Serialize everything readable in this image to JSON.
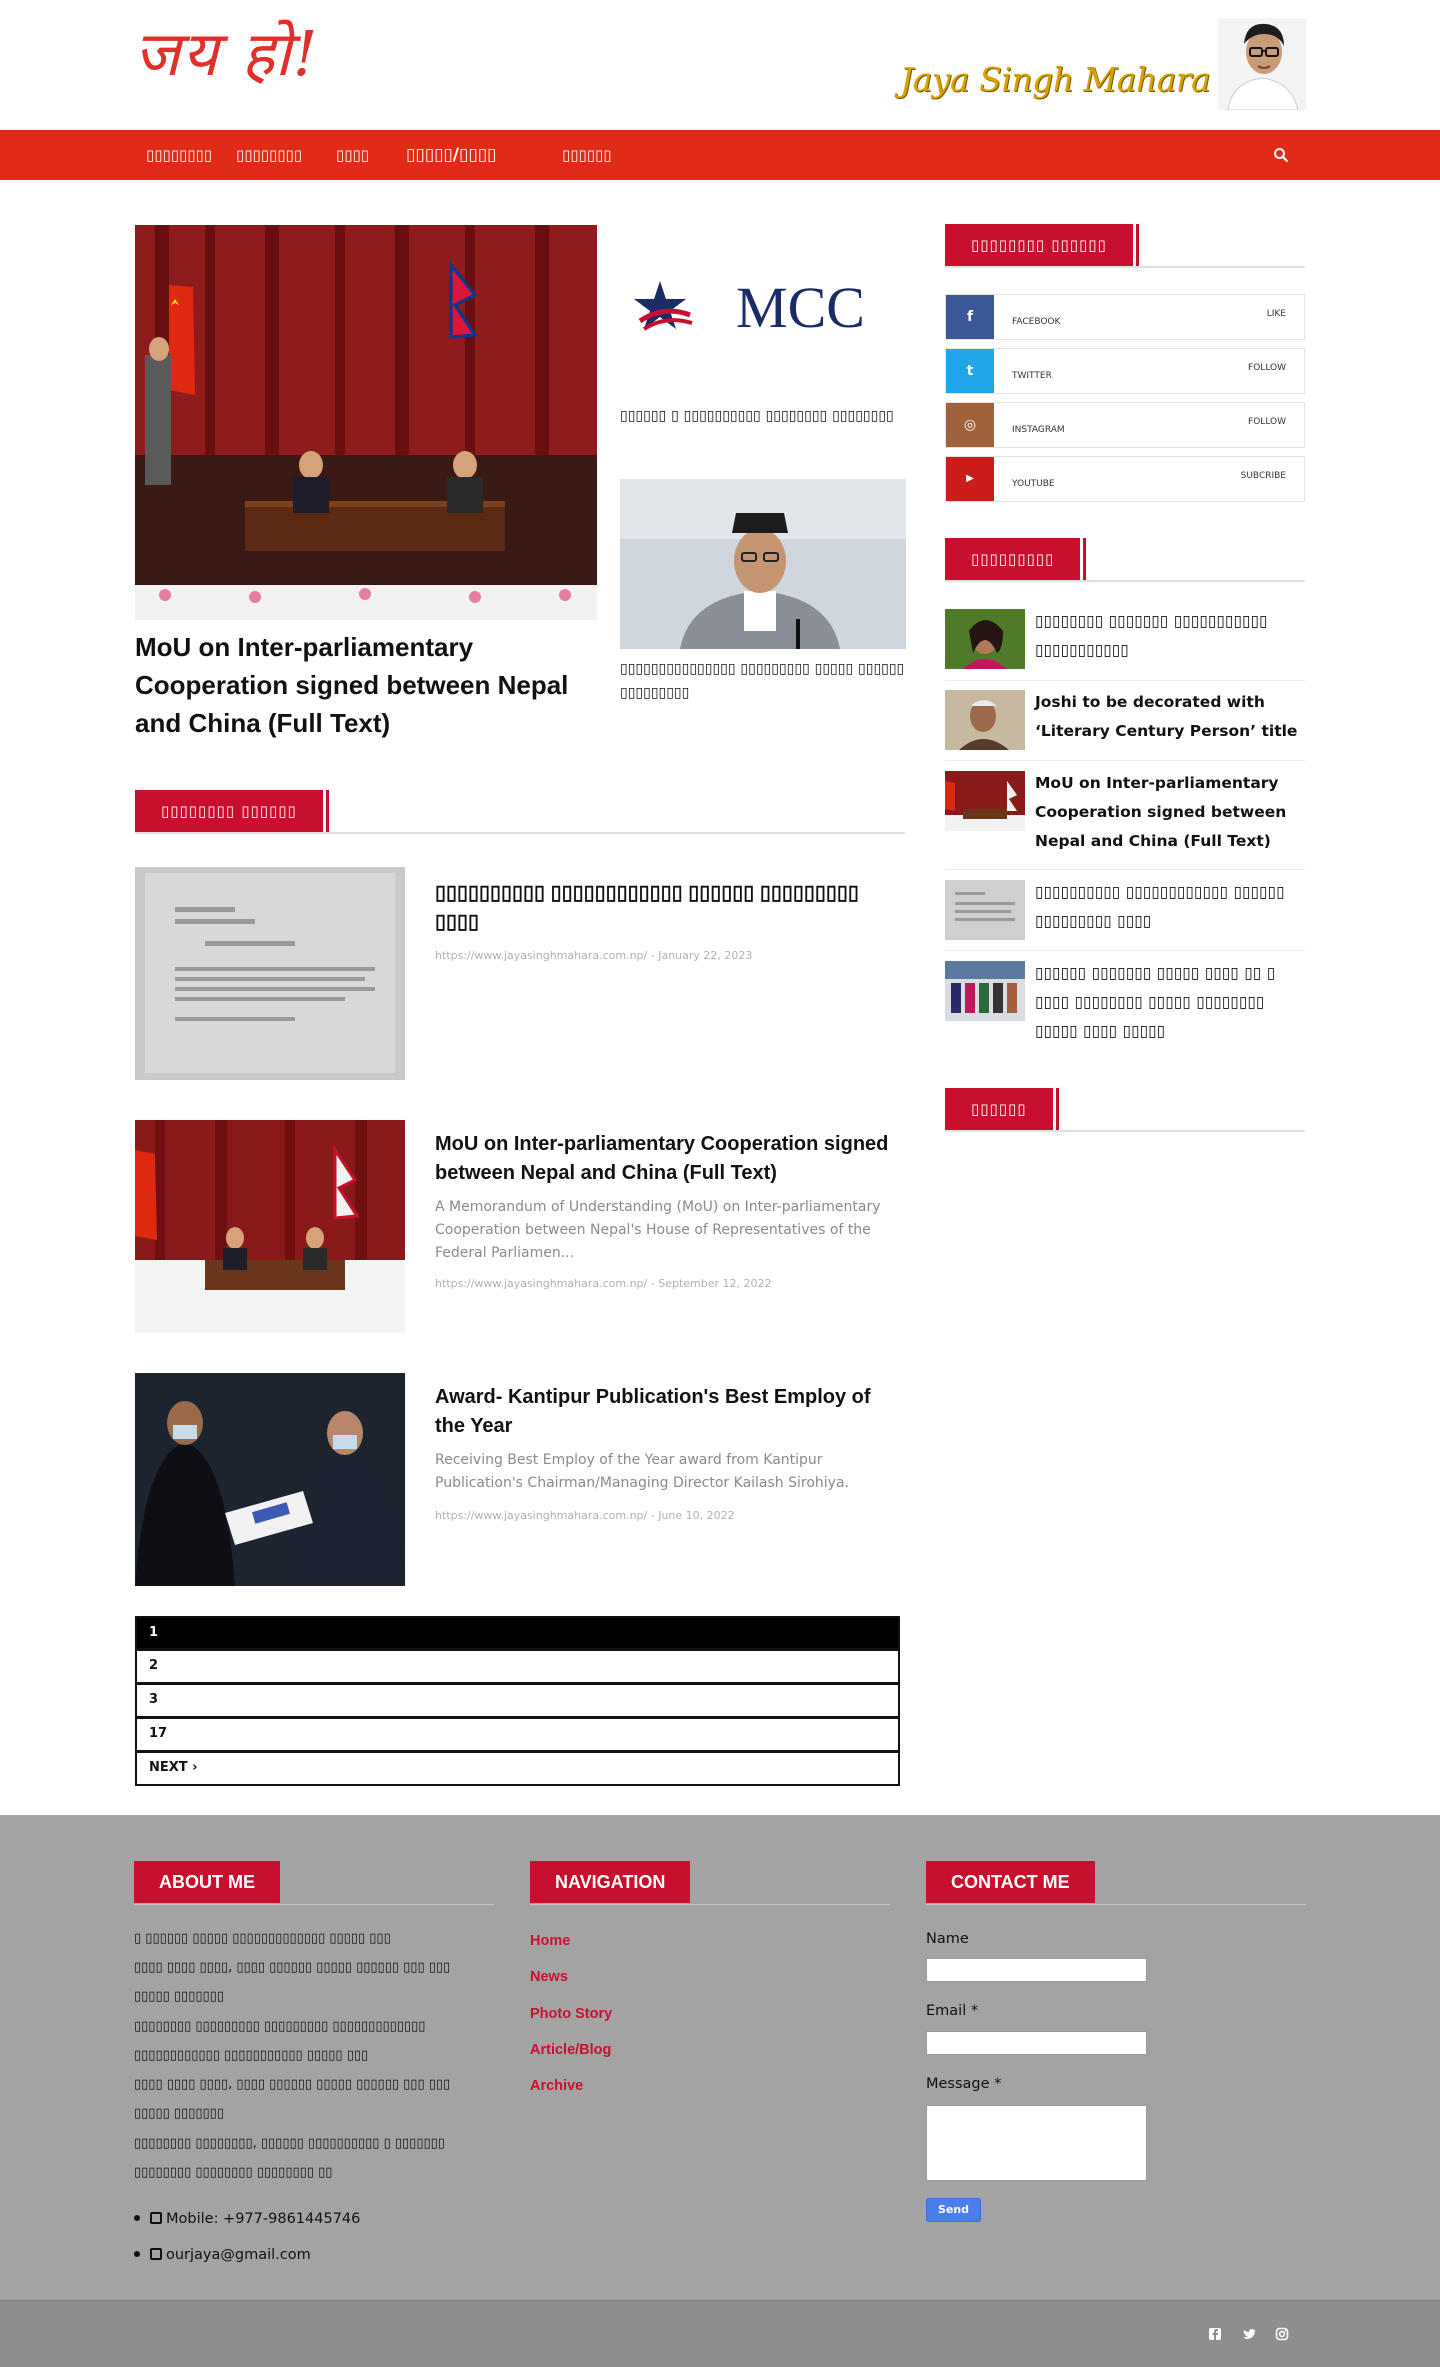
{
  "header": {
    "logo_text": "जय हो!",
    "banner_name": "Jaya Singh Mahara"
  },
  "nav": {
    "items": [
      "▯▯▯▯▯▯▯▯",
      "▯▯▯▯▯▯▯▯",
      "▯▯▯▯",
      "▯▯▯▯▯/▯▯▯▯",
      "▯▯▯▯▯▯"
    ],
    "search_icon": "search-icon"
  },
  "hero": {
    "main_title": "MoU on Inter-parliamentary Cooperation signed between Nepal and China (Full Text)",
    "side1_logo_text": "MCC",
    "side1_title": "▯▯▯▯▯▯ ▯ ▯▯▯▯▯▯▯▯▯▯ ▯▯▯▯▯▯▯▯ ▯▯▯▯▯▯▯▯",
    "side2_title": "▯▯▯▯▯▯▯▯▯▯▯▯▯▯▯ ▯▯▯▯▯▯▯▯▯ ▯▯▯▯▯ ▯▯▯▯▯▯ ▯▯▯▯▯▯▯▯▯"
  },
  "latest": {
    "heading": "▯▯▯▯▯▯▯▯ ▯▯▯▯▯▯",
    "posts": [
      {
        "title": "▯▯▯▯▯▯▯▯▯▯ ▯▯▯▯▯▯▯▯▯▯▯▯ ▯▯▯▯▯▯ ▯▯▯▯▯▯▯▯▯ ▯▯▯▯",
        "excerpt": "",
        "meta": "https://www.jayasinghmahara.com.np/ - January 22, 2023"
      },
      {
        "title": "MoU on Inter-parliamentary Cooperation signed between Nepal and China (Full Text)",
        "excerpt": "A Memorandum of Understanding (MoU) on Inter-parliamentary Cooperation between Nepal's House of Representatives of the Federal Parliamen...",
        "meta": "https://www.jayasinghmahara.com.np/ - September 12, 2022"
      },
      {
        "title": "Award- Kantipur Publication's Best Employ of the Year",
        "excerpt": "  Receiving Best Employ of the Year award from Kantipur Publication's Chairman/Managing Director Kailash Sirohiya.",
        "meta": "https://www.jayasinghmahara.com.np/ - June 10, 2022"
      }
    ],
    "pagination": [
      "1",
      "2",
      "3",
      "17",
      "NEXT ›"
    ]
  },
  "sidebar": {
    "follow_heading": "▯▯▯▯▯▯▯▯ ▯▯▯▯▯▯",
    "social": [
      {
        "icon": "f",
        "name": "FACEBOOK",
        "action": "LIKE",
        "color": "#3b5998"
      },
      {
        "icon": "t",
        "name": "TWITTER",
        "action": "FOLLOW",
        "color": "#1ea6e8"
      },
      {
        "icon": "◎",
        "name": "INSTAGRAM",
        "action": "FOLLOW",
        "color": "#a0613c"
      },
      {
        "icon": "▶",
        "name": "YOUTUBE",
        "action": "SUBCRIBE",
        "color": "#cc1d1d"
      }
    ],
    "popular_heading": "▯▯▯▯▯▯▯▯▯",
    "popular": [
      "▯▯▯▯▯▯▯▯ ▯▯▯▯▯▯▯ ▯▯▯▯▯▯▯▯▯▯▯ ▯▯▯▯▯▯▯▯▯▯▯",
      "Joshi to be decorated with ‘Literary Century Person’ title",
      "MoU on Inter-parliamentary Cooperation signed between Nepal and China (Full Text)",
      "▯▯▯▯▯▯▯▯▯▯ ▯▯▯▯▯▯▯▯▯▯▯▯ ▯▯▯▯▯▯ ▯▯▯▯▯▯▯▯▯ ▯▯▯▯",
      "▯▯▯▯▯▯ ▯▯▯▯▯▯▯ ▯▯▯▯▯ ▯▯▯▯ ▯▯ ▯ ▯▯▯▯ ▯▯▯▯▯▯▯▯ ▯▯▯▯▯ ▯▯▯▯▯▯▯▯ ▯▯▯▯▯ ▯▯▯▯ ▯▯▯▯▯"
    ],
    "third_heading": "▯▯▯▯▯▯"
  },
  "footer": {
    "about_heading": "ABOUT ME",
    "about_lines": [
      "▯ ▯▯▯▯▯▯ ▯▯▯▯▯ ▯▯▯▯▯▯▯▯▯▯▯▯▯ ▯▯▯▯▯ ▯▯▯",
      "▯▯▯▯ ▯▯▯▯ ▯▯▯▯, ▯▯▯▯ ▯▯▯▯▯▯ ▯▯▯▯▯ ▯▯▯▯▯▯ ▯▯▯ ▯▯▯",
      "▯▯▯▯▯ ▯▯▯▯▯▯▯",
      "▯▯▯▯▯▯▯▯ ▯▯▯▯▯▯▯▯▯ ▯▯▯▯▯▯▯▯▯ ▯▯▯▯▯▯▯▯▯▯▯▯▯",
      "▯▯▯▯▯▯▯▯▯▯▯▯ ▯▯▯▯▯▯▯▯▯▯▯ ▯▯▯▯▯ ▯▯▯",
      "▯▯▯▯ ▯▯▯▯ ▯▯▯▯, ▯▯▯▯ ▯▯▯▯▯▯ ▯▯▯▯▯ ▯▯▯▯▯▯ ▯▯▯ ▯▯▯",
      "▯▯▯▯▯ ▯▯▯▯▯▯▯",
      "▯▯▯▯▯▯▯▯ ▯▯▯▯▯▯▯▯, ▯▯▯▯▯▯ ▯▯▯▯▯▯▯▯▯▯ ▯ ▯▯▯▯▯▯▯",
      "▯▯▯▯▯▯▯▯ ▯▯▯▯▯▯▯▯ ▯▯▯▯▯▯▯▯ ▯▯"
    ],
    "mobile": "Mobile: +977-9861445746",
    "email": "ourjaya@gmail.com",
    "nav_heading": "NAVIGATION",
    "nav_links": [
      "Home",
      "News",
      "Photo Story",
      "Article/Blog",
      "Archive"
    ],
    "contact_heading": "CONTACT ME",
    "form": {
      "name_label": "Name",
      "email_label": "Email",
      "message_label": "Message",
      "required_mark": "*",
      "send_label": "Send"
    }
  },
  "colors": {
    "brand_red": "#e12b17",
    "label_red": "#c8102e",
    "footer_bg": "#a3a3a3"
  }
}
